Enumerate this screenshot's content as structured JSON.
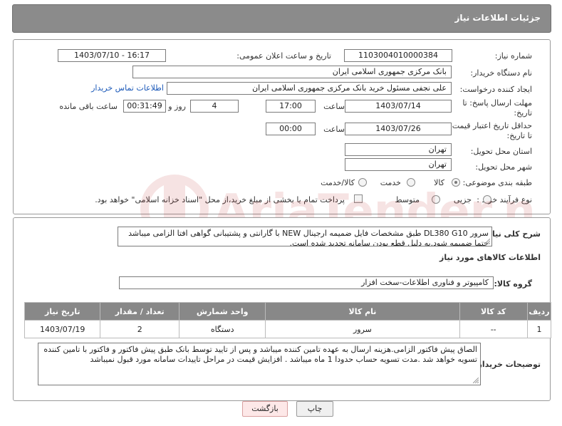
{
  "header": {
    "title": "جزئیات اطلاعات نیاز"
  },
  "form": {
    "need_number": {
      "label": "شماره نیاز:",
      "value": "1103004010000384"
    },
    "announce_datetime": {
      "label": "تاریخ و ساعت اعلان عمومی:",
      "value": "1403/07/10 - 16:17"
    },
    "buyer_org": {
      "label": "نام دستگاه خریدار:",
      "value": "بانک مرکزی جمهوری اسلامی ایران"
    },
    "requester": {
      "label": "ایجاد کننده درخواست:",
      "value": "علی  نجفی مسئول خرید بانک مرکزی جمهوری اسلامی ایران",
      "contact_link": "اطلاعات تماس خریدار"
    },
    "reply_deadline": {
      "label": "مهلت ارسال پاسخ: تا تاریخ:",
      "date": "1403/07/14",
      "time_label": "ساعت",
      "time": "17:00",
      "days": "4",
      "days_label": "روز و",
      "remaining": "00:31:49",
      "remaining_label": "ساعت باقی مانده"
    },
    "price_validity": {
      "label": "حداقل تاریخ اعتبار قیمت: تا تاریخ:",
      "date": "1403/07/26",
      "time_label": "ساعت",
      "time": "00:00"
    },
    "province": {
      "label": "استان محل تحویل:",
      "value": "تهران"
    },
    "city": {
      "label": "شهر محل تحویل:",
      "value": "تهران"
    },
    "category": {
      "label": "طبقه بندی موضوعی:",
      "options": [
        "کالا",
        "خدمت",
        "کالا/خدمت"
      ],
      "selected": "کالا"
    },
    "process_type": {
      "label": "نوع فرآیند خرید :",
      "options": [
        "جزیی",
        "متوسط"
      ],
      "selected": "",
      "payment_note": "پرداخت تمام یا بخشی از مبلغ خرید،از محل \"اسناد خزانه اسلامی\" خواهد بود."
    }
  },
  "description": {
    "label": "شرح کلی نیاز:",
    "text": "سرور DL380 G10 طبق مشخصات فایل ضمیمه ارجینال NEW با گارانتی و پشتیبانی گواهی افتا الزامی میباشد حتما ضمیمه شود.به دلیل قطع بودن سامانه تجدید شده است."
  },
  "goods_section": {
    "title": "اطلاعات کالاهای مورد نیاز",
    "group_label": "گروه کالا:",
    "group_value": "کامپیوتر و فناوری اطلاعات-سخت افزار",
    "table": {
      "headers": [
        "ردیف",
        "کد کالا",
        "نام کالا",
        "واحد شمارش",
        "تعداد / مقدار",
        "تاریخ نیاز"
      ],
      "rows": [
        [
          "1",
          "--",
          "سرور",
          "دستگاه",
          "2",
          "1403/07/19"
        ]
      ]
    }
  },
  "buyer_notes": {
    "label": "توضیحات خریدار:",
    "text": "الصاق پیش فاکتور الزامی.هزینه ارسال به عهده تامین کننده میباشد و پس از تایید توسط بانک طبق پیش فاکتور و فاکتور با تامین کننده تسویه خواهد شد .مدت تسویه حساب حدودا 1 ماه میباشد . افزایش قیمت در مراحل تاییدات سامانه مورد قبول نمیباشد"
  },
  "buttons": {
    "print": "چاپ",
    "back": "بازگشت"
  },
  "watermark": {
    "text": "AriaTender.neT"
  },
  "colors": {
    "header_bg": "#8b8b8b",
    "link": "#1a58b8",
    "table_header_bg": "#888888",
    "back_button_bg": "#fde8e8"
  }
}
